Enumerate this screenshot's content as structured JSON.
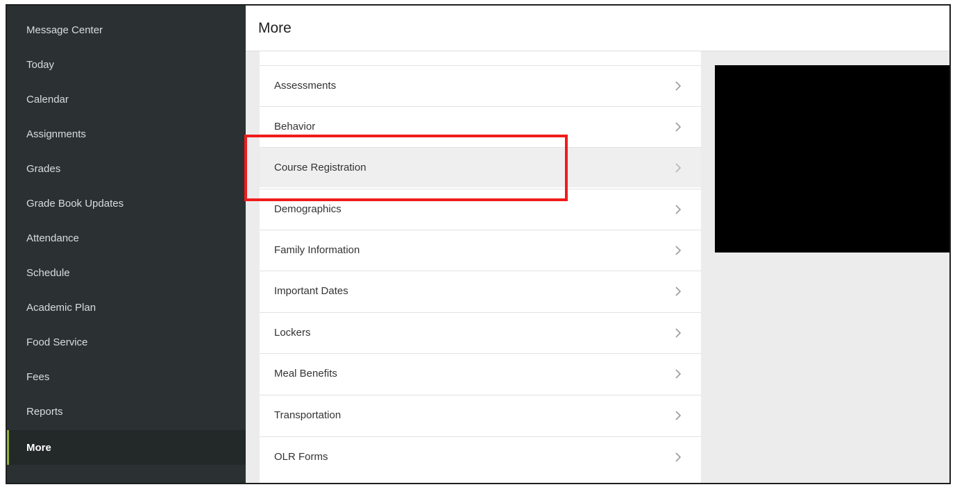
{
  "sidebar": {
    "items": [
      {
        "label": "Message Center"
      },
      {
        "label": "Today"
      },
      {
        "label": "Calendar"
      },
      {
        "label": "Assignments"
      },
      {
        "label": "Grades"
      },
      {
        "label": "Grade Book Updates"
      },
      {
        "label": "Attendance"
      },
      {
        "label": "Schedule"
      },
      {
        "label": "Academic Plan"
      },
      {
        "label": "Food Service"
      },
      {
        "label": "Fees"
      },
      {
        "label": "Reports"
      },
      {
        "label": "More"
      }
    ],
    "active_item": "More",
    "accent_color": "#8fb23a"
  },
  "header": {
    "title": "More"
  },
  "menu": {
    "items": [
      {
        "label": "Assessments"
      },
      {
        "label": "Behavior"
      },
      {
        "label": "Course Registration"
      },
      {
        "label": "Demographics"
      },
      {
        "label": "Family Information"
      },
      {
        "label": "Important Dates"
      },
      {
        "label": "Lockers"
      },
      {
        "label": "Meal Benefits"
      },
      {
        "label": "Transportation"
      },
      {
        "label": "OLR Forms"
      }
    ],
    "highlighted_item": "Course Registration",
    "item_icon": "chevron-right-icon"
  },
  "annotation": {
    "color": "#f01b1b"
  }
}
